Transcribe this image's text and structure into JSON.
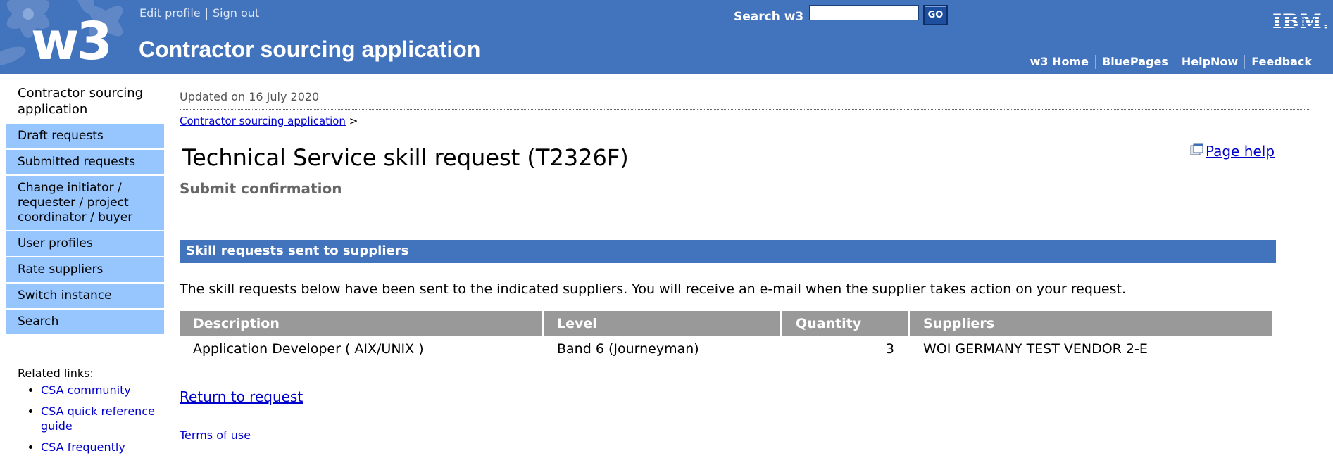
{
  "header": {
    "logo_text": "w3",
    "app_title": "Contractor sourcing application",
    "edit_profile": "Edit profile",
    "separator": "|",
    "sign_out": "Sign out",
    "search_label": "Search w3",
    "search_value": "",
    "go_label": "GO",
    "ibm_logo": "IBM.",
    "nav": [
      "w3 Home",
      "BluePages",
      "HelpNow",
      "Feedback"
    ],
    "brand_color": "#4273bd"
  },
  "leftnav": {
    "title": "Contractor sourcing application",
    "items": [
      "Draft requests",
      "Submitted requests",
      "Change initiator / requester / project coordinator / buyer",
      "User profiles",
      "Rate suppliers",
      "Switch instance",
      "Search"
    ],
    "item_color": "#97c6ff",
    "related_title": "Related links:",
    "related_links": [
      "CSA community",
      "CSA quick reference guide",
      "CSA frequently"
    ]
  },
  "main": {
    "updated": "Updated on 16 July 2020",
    "breadcrumb_link": "Contractor sourcing application",
    "breadcrumb_sep": ">",
    "page_help_icon": "help-window-icon",
    "page_title": "Technical Service skill request (T2326F)",
    "page_help": "Page help",
    "subtitle": "Submit confirmation",
    "section_title": "Skill requests sent to suppliers",
    "intro": "The skill requests below have been sent to the indicated suppliers. You will receive an e-mail when the supplier takes action on your request.",
    "table": {
      "headers": [
        "Description",
        "Level",
        "Quantity",
        "Suppliers"
      ],
      "rows": [
        [
          "Application Developer ( AIX/UNIX )",
          "Band 6 (Journeyman)",
          "3",
          "WOI GERMANY TEST VENDOR 2-E"
        ]
      ]
    },
    "return_link": "Return to request",
    "terms": "Terms of use"
  }
}
